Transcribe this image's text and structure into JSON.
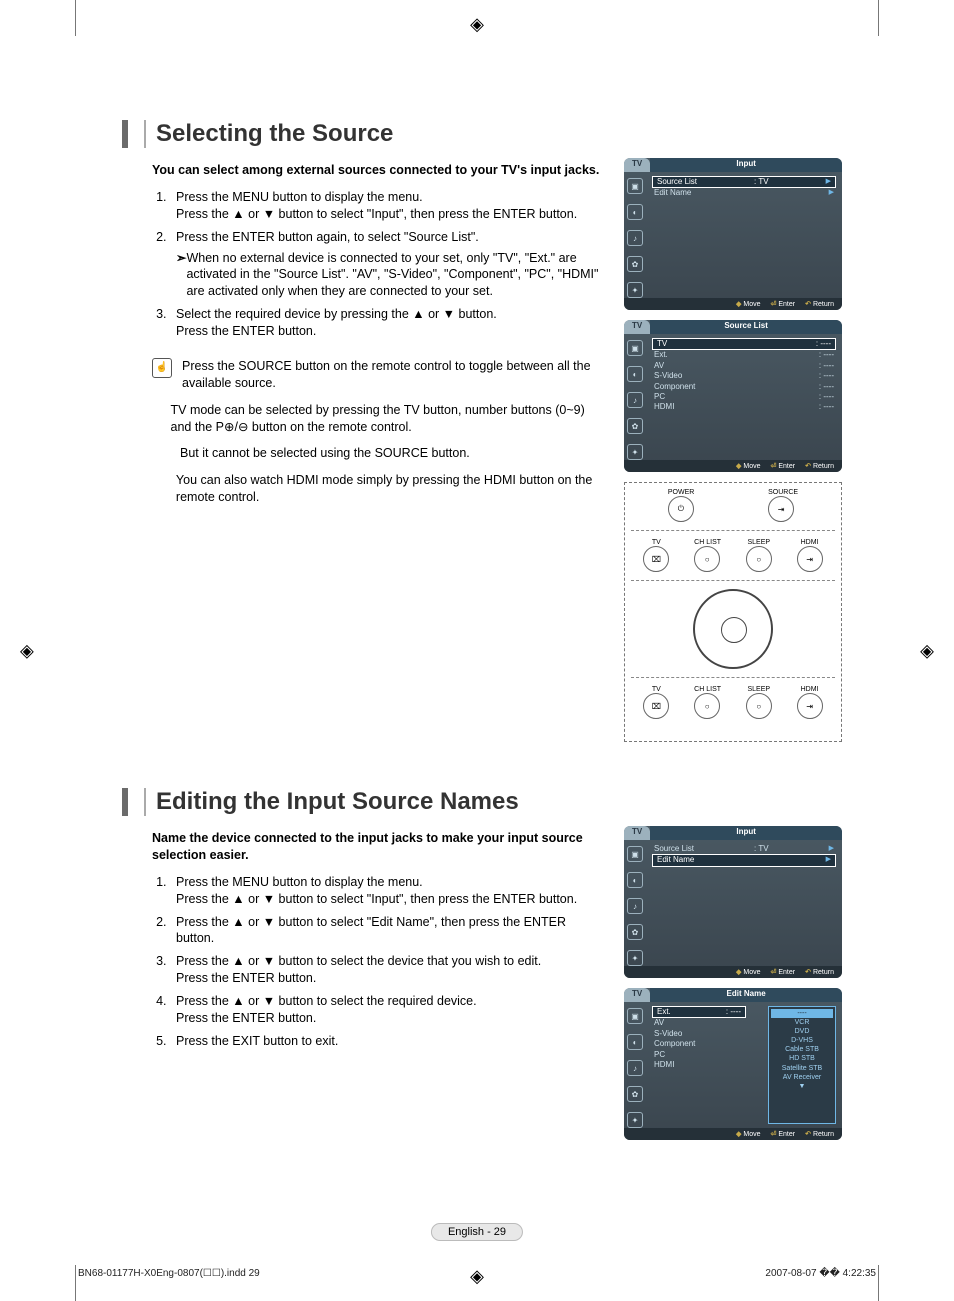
{
  "section1": {
    "title": "Selecting the Source",
    "intro": "You can select among external sources connected to your TV's input jacks.",
    "step1a": "Press the MENU button to display the menu.",
    "step1b": "Press the ▲ or ▼ button to select \"Input\", then press the ENTER button.",
    "step2a": "Press the ENTER button again, to select \"Source List\".",
    "step2note": "When no external device is connected to your set, only \"TV\", \"Ext.\" are activated in the \"Source List\". \"AV\", \"S-Video\", \"Component\", \"PC\", \"HDMI\" are activated only when they are connected to your set.",
    "step3a": "Select the required device by pressing the ▲ or ▼ button.",
    "step3b": "Press the ENTER button.",
    "pm1": "Press the SOURCE button on the remote control to toggle between all the available source.",
    "pm2": "TV mode can be selected by pressing the TV button, number buttons (0~9) and the P⊕/⊖ button on the remote control.",
    "pm3": "But it cannot be selected using the SOURCE button.",
    "pm4": "You can also watch HDMI mode simply by pressing the HDMI button on the remote control."
  },
  "section2": {
    "title": "Editing the Input Source Names",
    "intro": "Name the device connected to the input jacks to make your input source selection easier.",
    "step1a": "Press the MENU button to display the menu.",
    "step1b": "Press the ▲ or ▼ button to select \"Input\", then press the ENTER button.",
    "step2": "Press the ▲ or ▼ button to select \"Edit Name\", then press the ENTER button.",
    "step3a": "Press the ▲ or ▼ button to select the device that you wish to edit.",
    "step3b": "Press the ENTER button.",
    "step4a": "Press the ▲ or ▼ button to select the required device.",
    "step4b": "Press the ENTER button.",
    "step5": "Press the EXIT button to exit."
  },
  "osd": {
    "input_tab": "TV",
    "input_title": "Input",
    "source_list_label": "Source List",
    "source_list_value": ":   TV",
    "edit_name_label": "Edit Name",
    "move": "Move",
    "enter": "Enter",
    "return": "Return",
    "sl_title": "Source List",
    "sl_rows": [
      {
        "lbl": "TV",
        "val": ": ----"
      },
      {
        "lbl": "Ext.",
        "val": ": ----"
      },
      {
        "lbl": "AV",
        "val": ": ----"
      },
      {
        "lbl": "S-Video",
        "val": ": ----"
      },
      {
        "lbl": "Component",
        "val": ": ----"
      },
      {
        "lbl": "PC",
        "val": ": ----"
      },
      {
        "lbl": "HDMI",
        "val": ": ----"
      }
    ],
    "en_title": "Edit Name",
    "en_rows": [
      {
        "lbl": "Ext.",
        "val": ": ----"
      },
      {
        "lbl": "AV",
        "val": ""
      },
      {
        "lbl": "S-Video",
        "val": ""
      },
      {
        "lbl": "Component",
        "val": ""
      },
      {
        "lbl": "PC",
        "val": ""
      },
      {
        "lbl": "HDMI",
        "val": ""
      }
    ],
    "dropdown": [
      "----",
      "VCR",
      "DVD",
      "D-VHS",
      "Cable STB",
      "HD STB",
      "Satellite STB",
      "AV Receiver",
      "▼"
    ]
  },
  "remote": {
    "power": "POWER",
    "source": "SOURCE",
    "tv": "TV",
    "chlist": "CH LIST",
    "sleep": "SLEEP",
    "hdmi": "HDMI"
  },
  "footer": {
    "page": "English - 29",
    "file": "BN68-01177H-X0Eng-0807(☐☐).indd   29",
    "stamp": "2007-08-07   �� 4:22:35"
  }
}
